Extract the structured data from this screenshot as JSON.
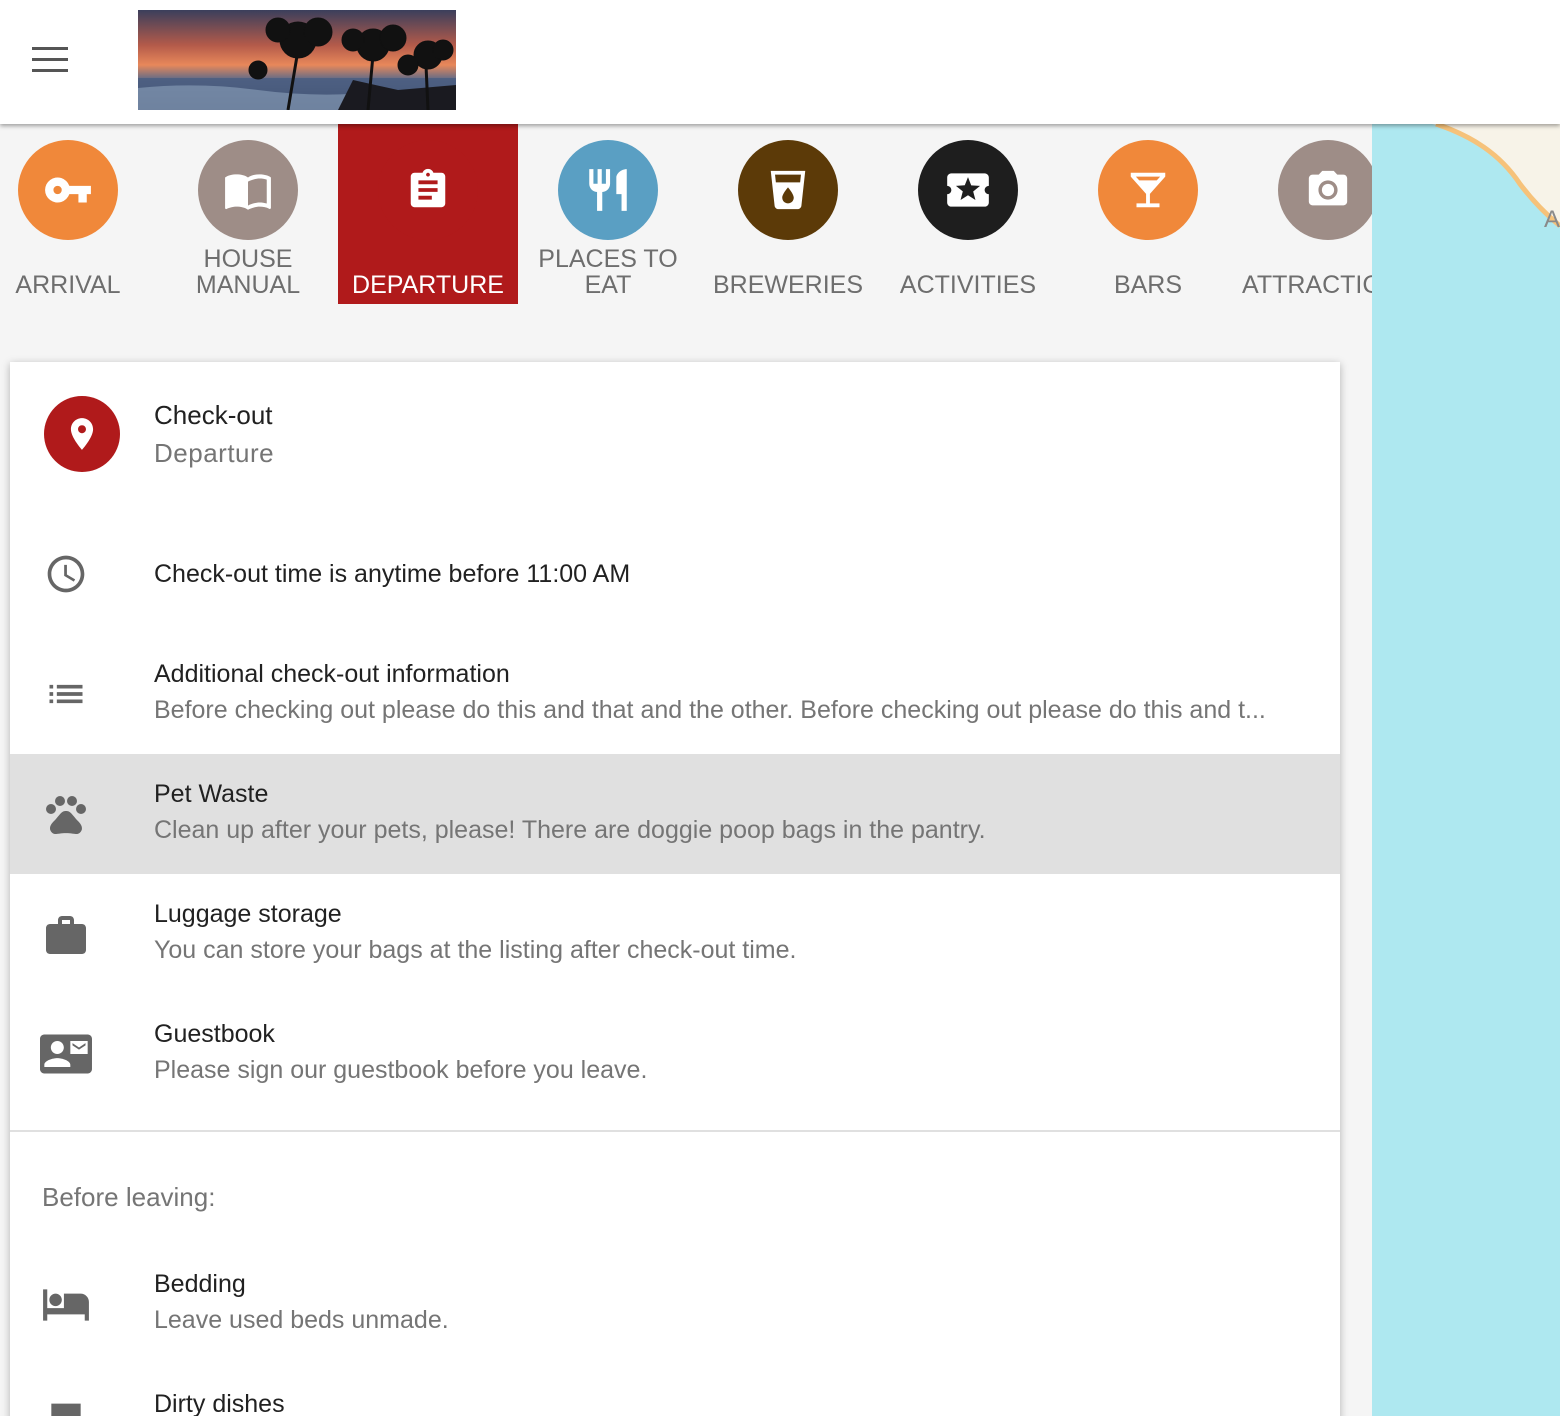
{
  "header": {
    "menu_icon": "hamburger-menu-icon",
    "logo_alt": "sunset-beach-palms-logo"
  },
  "nav": {
    "items": [
      {
        "label": "ARRIVAL",
        "icon": "key-icon",
        "color": "#f0883a",
        "active": false
      },
      {
        "label": "HOUSE\nMANUAL",
        "icon": "book-icon",
        "color": "#9e8d87",
        "active": false
      },
      {
        "label": "DEPARTURE",
        "icon": "clipboard-icon",
        "color": "#b01a1b",
        "active": true
      },
      {
        "label": "PLACES TO\nEAT",
        "icon": "fork-knife-icon",
        "color": "#5a9fc3",
        "active": false
      },
      {
        "label": "BREWERIES",
        "icon": "beer-glass-icon",
        "color": "#5c3a08",
        "active": false
      },
      {
        "label": "ACTIVITIES",
        "icon": "ticket-star-icon",
        "color": "#1e1e1e",
        "active": false
      },
      {
        "label": "BARS",
        "icon": "cocktail-icon",
        "color": "#f0883a",
        "active": false
      },
      {
        "label": "ATTRACTIC",
        "icon": "camera-icon",
        "color": "#9e8d87",
        "active": false
      }
    ]
  },
  "card": {
    "title": "Check-out",
    "subtitle": "Departure",
    "rows": [
      {
        "icon": "clock-icon",
        "title": "Check-out time is anytime before 11:00 AM",
        "desc": ""
      },
      {
        "icon": "list-icon",
        "title": "Additional check-out information",
        "desc": "Before checking out please do this and that and the other. Before checking out please do this and t..."
      },
      {
        "icon": "paw-icon",
        "title": "Pet Waste",
        "desc": "Clean up after your pets, please! There are doggie poop bags in the pantry."
      },
      {
        "icon": "briefcase-icon",
        "title": "Luggage storage",
        "desc": "You can store your bags at the listing after check-out time."
      },
      {
        "icon": "contact-mail-icon",
        "title": "Guestbook",
        "desc": "Please sign our guestbook before you leave."
      }
    ],
    "section_title": "Before leaving:",
    "section_rows": [
      {
        "icon": "bed-icon",
        "title": "Bedding",
        "desc": "Leave used beds unmade."
      },
      {
        "icon": "dishwasher-icon",
        "title": "Dirty dishes",
        "desc": ""
      }
    ]
  },
  "map": {
    "label": "A"
  },
  "colors": {
    "accent": "#b01a1b",
    "highlight_row": "#e0e0e0",
    "map_water": "#aee8f0"
  }
}
